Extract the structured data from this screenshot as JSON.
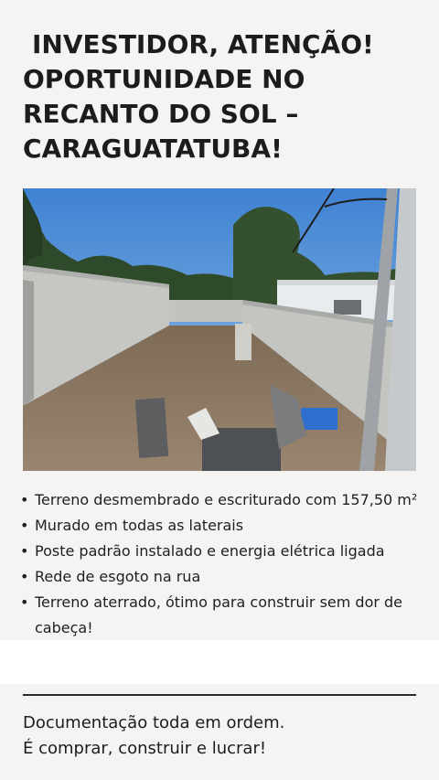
{
  "headline": {
    "line1": "INVESTIDOR, ATENÇÃO!",
    "line2": "OPORTUNIDADE NO",
    "line3": "RECANTO DO SOL –",
    "line4": "CARAGUATATUBA!"
  },
  "bullets": [
    "Terreno desmembrado e escriturado com 157,50 m²",
    "Murado em todas as laterais",
    "Poste padrão instalado e energia elétrica ligada",
    "Rede de esgoto na rua",
    "Terreno aterrado, ótimo para construir sem dor de cabeça!"
  ],
  "bullet_glyph": "•",
  "closing": {
    "line1": "Documentação toda em ordem.",
    "line2": "É comprar, construir e lucrar!"
  },
  "colors": {
    "background": "#f6f4f2",
    "text": "#1c1c1c",
    "sky": "#4d8fd6",
    "wall": "#c9cac6",
    "soil": "#8a7560"
  }
}
